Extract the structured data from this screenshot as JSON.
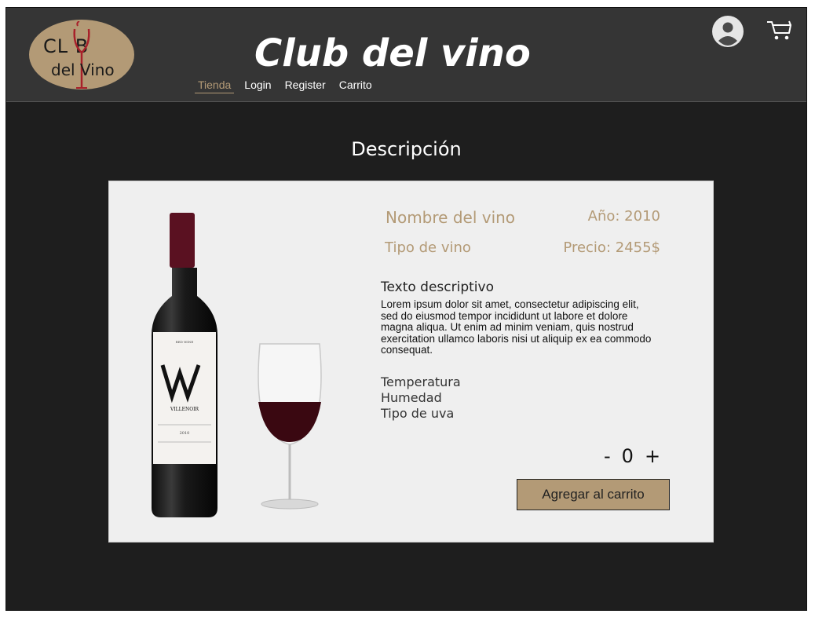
{
  "header": {
    "logo": {
      "text_top": "CL  B",
      "text_bottom": "del Vino"
    },
    "title": "Club del vino",
    "nav": [
      {
        "label": "Tienda",
        "active": true
      },
      {
        "label": "Login",
        "active": false
      },
      {
        "label": "Register",
        "active": false
      },
      {
        "label": "Carrito",
        "active": false
      }
    ],
    "icons": {
      "user": "user-avatar-icon",
      "cart": "shopping-cart-icon"
    }
  },
  "main": {
    "section_title": "Descripción",
    "product": {
      "name": "Nombre del vino",
      "year": "Año: 2010",
      "type": "Tipo de vino",
      "price": "Precio: 2455$",
      "description_title": "Texto descriptivo",
      "description": "Lorem ipsum dolor sit amet, consectetur adipiscing elit, sed do eiusmod tempor incididunt ut labore et dolore magna aliqua. Ut enim ad minim veniam, quis nostrud exercitation ullamco laboris nisi ut aliquip ex ea commodo consequat.",
      "attributes": [
        "Temperatura",
        "Humedad",
        "Tipo de uva"
      ],
      "quantity": {
        "minus": "-",
        "value": "0",
        "plus": "+"
      },
      "add_to_cart": "Agregar al carrito",
      "bottle_label": {
        "brand": "VILLENOIR",
        "top_label": "RED WINE",
        "vintage": "2010"
      }
    }
  },
  "colors": {
    "accent": "#b39a76",
    "header_bg": "#353535",
    "page_bg": "#1e1e1e",
    "card_bg": "#efefef"
  }
}
